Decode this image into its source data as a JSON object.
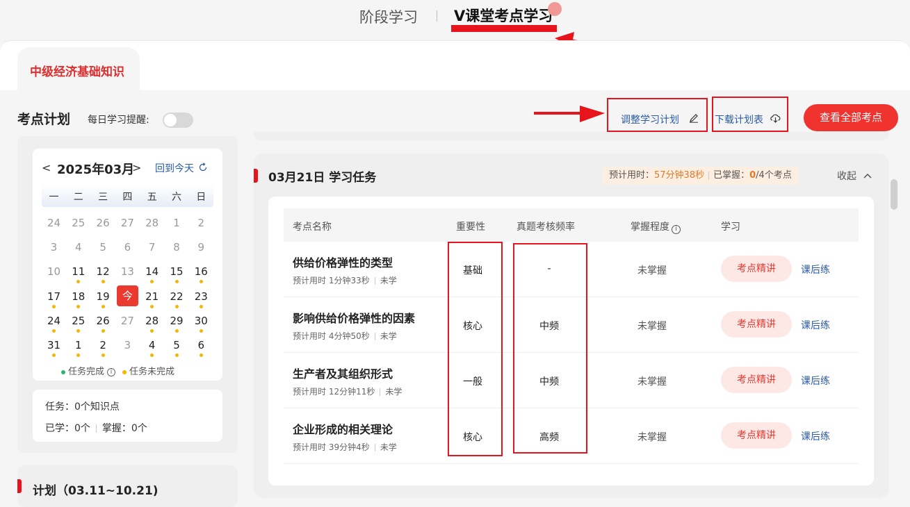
{
  "nav": {
    "tab_stage": "阶段学习",
    "tab_vclass": "V课堂考点学习"
  },
  "course_tab": "中级经济基础知识",
  "plan": {
    "title": "考点计划",
    "reminder_label": "每日学习提醒:",
    "reminder_on": false,
    "adjust_label": "调整学习计划",
    "download_label": "下载计划表",
    "view_all_label": "查看全部考点"
  },
  "calendar": {
    "title": "2025年03月",
    "prev": "<",
    "next": ">",
    "today_btn": "回到今天",
    "weekdays": [
      "一",
      "二",
      "三",
      "四",
      "五",
      "六",
      "日"
    ],
    "weeks": [
      [
        {
          "d": "24",
          "m": "dim"
        },
        {
          "d": "25",
          "m": "dim"
        },
        {
          "d": "26",
          "m": "dim"
        },
        {
          "d": "27",
          "m": "dim"
        },
        {
          "d": "28",
          "m": "dim"
        },
        {
          "d": "1",
          "m": "dim"
        },
        {
          "d": "2",
          "m": "dim"
        }
      ],
      [
        {
          "d": "3",
          "m": "dim"
        },
        {
          "d": "4",
          "m": "dim"
        },
        {
          "d": "5",
          "m": "dim"
        },
        {
          "d": "6",
          "m": "dim"
        },
        {
          "d": "7",
          "m": "dim"
        },
        {
          "d": "8",
          "m": "dim"
        },
        {
          "d": "9",
          "m": "dim"
        }
      ],
      [
        {
          "d": "10",
          "m": "dim"
        },
        {
          "d": "11",
          "m": "cur",
          "dot": true
        },
        {
          "d": "12",
          "m": "cur",
          "dot": true
        },
        {
          "d": "13",
          "m": "dim"
        },
        {
          "d": "14",
          "m": "cur",
          "dot": true
        },
        {
          "d": "15",
          "m": "cur",
          "dot": true
        },
        {
          "d": "16",
          "m": "cur",
          "dot": true
        }
      ],
      [
        {
          "d": "17",
          "m": "cur",
          "dot": true
        },
        {
          "d": "18",
          "m": "cur",
          "dot": true
        },
        {
          "d": "19",
          "m": "cur",
          "dot": true
        },
        {
          "d": "今",
          "m": "today"
        },
        {
          "d": "21",
          "m": "cur",
          "dot": true
        },
        {
          "d": "22",
          "m": "cur",
          "dot": true
        },
        {
          "d": "23",
          "m": "cur",
          "dot": true
        }
      ],
      [
        {
          "d": "24",
          "m": "cur",
          "dot": true
        },
        {
          "d": "25",
          "m": "cur",
          "dot": true
        },
        {
          "d": "26",
          "m": "cur",
          "dot": true
        },
        {
          "d": "27",
          "m": "dim"
        },
        {
          "d": "28",
          "m": "cur",
          "dot": true
        },
        {
          "d": "29",
          "m": "cur",
          "dot": true
        },
        {
          "d": "30",
          "m": "cur",
          "dot": true
        }
      ],
      [
        {
          "d": "31",
          "m": "cur",
          "dot": true
        },
        {
          "d": "1",
          "m": "cur",
          "dot": true
        },
        {
          "d": "2",
          "m": "cur",
          "dot": true
        },
        {
          "d": "3",
          "m": "dim"
        },
        {
          "d": "4",
          "m": "cur",
          "dot": true
        },
        {
          "d": "5",
          "m": "cur",
          "dot": true
        },
        {
          "d": "6",
          "m": "cur",
          "dot": true
        }
      ]
    ],
    "legend_done": "任务完成",
    "legend_undone": "任务未完成",
    "done_color": "#2db36b",
    "undone_color": "#f2b705"
  },
  "stats": {
    "task": "任务：0个知识点",
    "learned": "已学：0个",
    "mastered": "掌握：0个"
  },
  "period": "计划（03.11~10.21)",
  "task": {
    "title": "03月21日 学习任务",
    "meta_time_label": "预计用时：",
    "meta_time_value": "57分钟38秒",
    "meta_master_label": "已掌握：",
    "meta_master_done": "0",
    "meta_master_total": "/4个考点",
    "collapse": "收起"
  },
  "table": {
    "headers": {
      "name": "考点名称",
      "importance": "重要性",
      "frequency": "真题考核频率",
      "mastery": "掌握程度",
      "study": "学习"
    },
    "lecture_label": "考点精讲",
    "practice_label": "课后练",
    "rows": [
      {
        "name": "供给价格弹性的类型",
        "time": "预计用时 1分钟33秒",
        "status": "未学",
        "importance": "基础",
        "frequency": "-",
        "mastery": "未掌握"
      },
      {
        "name": "影响供给价格弹性的因素",
        "time": "预计用时 4分钟50秒",
        "status": "未学",
        "importance": "核心",
        "frequency": "中频",
        "mastery": "未掌握"
      },
      {
        "name": "生产者及其组织形式",
        "time": "预计用时 12分钟11秒",
        "status": "未学",
        "importance": "一般",
        "frequency": "中频",
        "mastery": "未掌握"
      },
      {
        "name": "企业形成的相关理论",
        "time": "预计用时 39分钟4秒",
        "status": "未学",
        "importance": "核心",
        "frequency": "高频",
        "mastery": "未掌握"
      }
    ]
  },
  "colors": {
    "accent": "#f0332f",
    "link": "#2a5aa8",
    "annotation": "#e8141c"
  }
}
